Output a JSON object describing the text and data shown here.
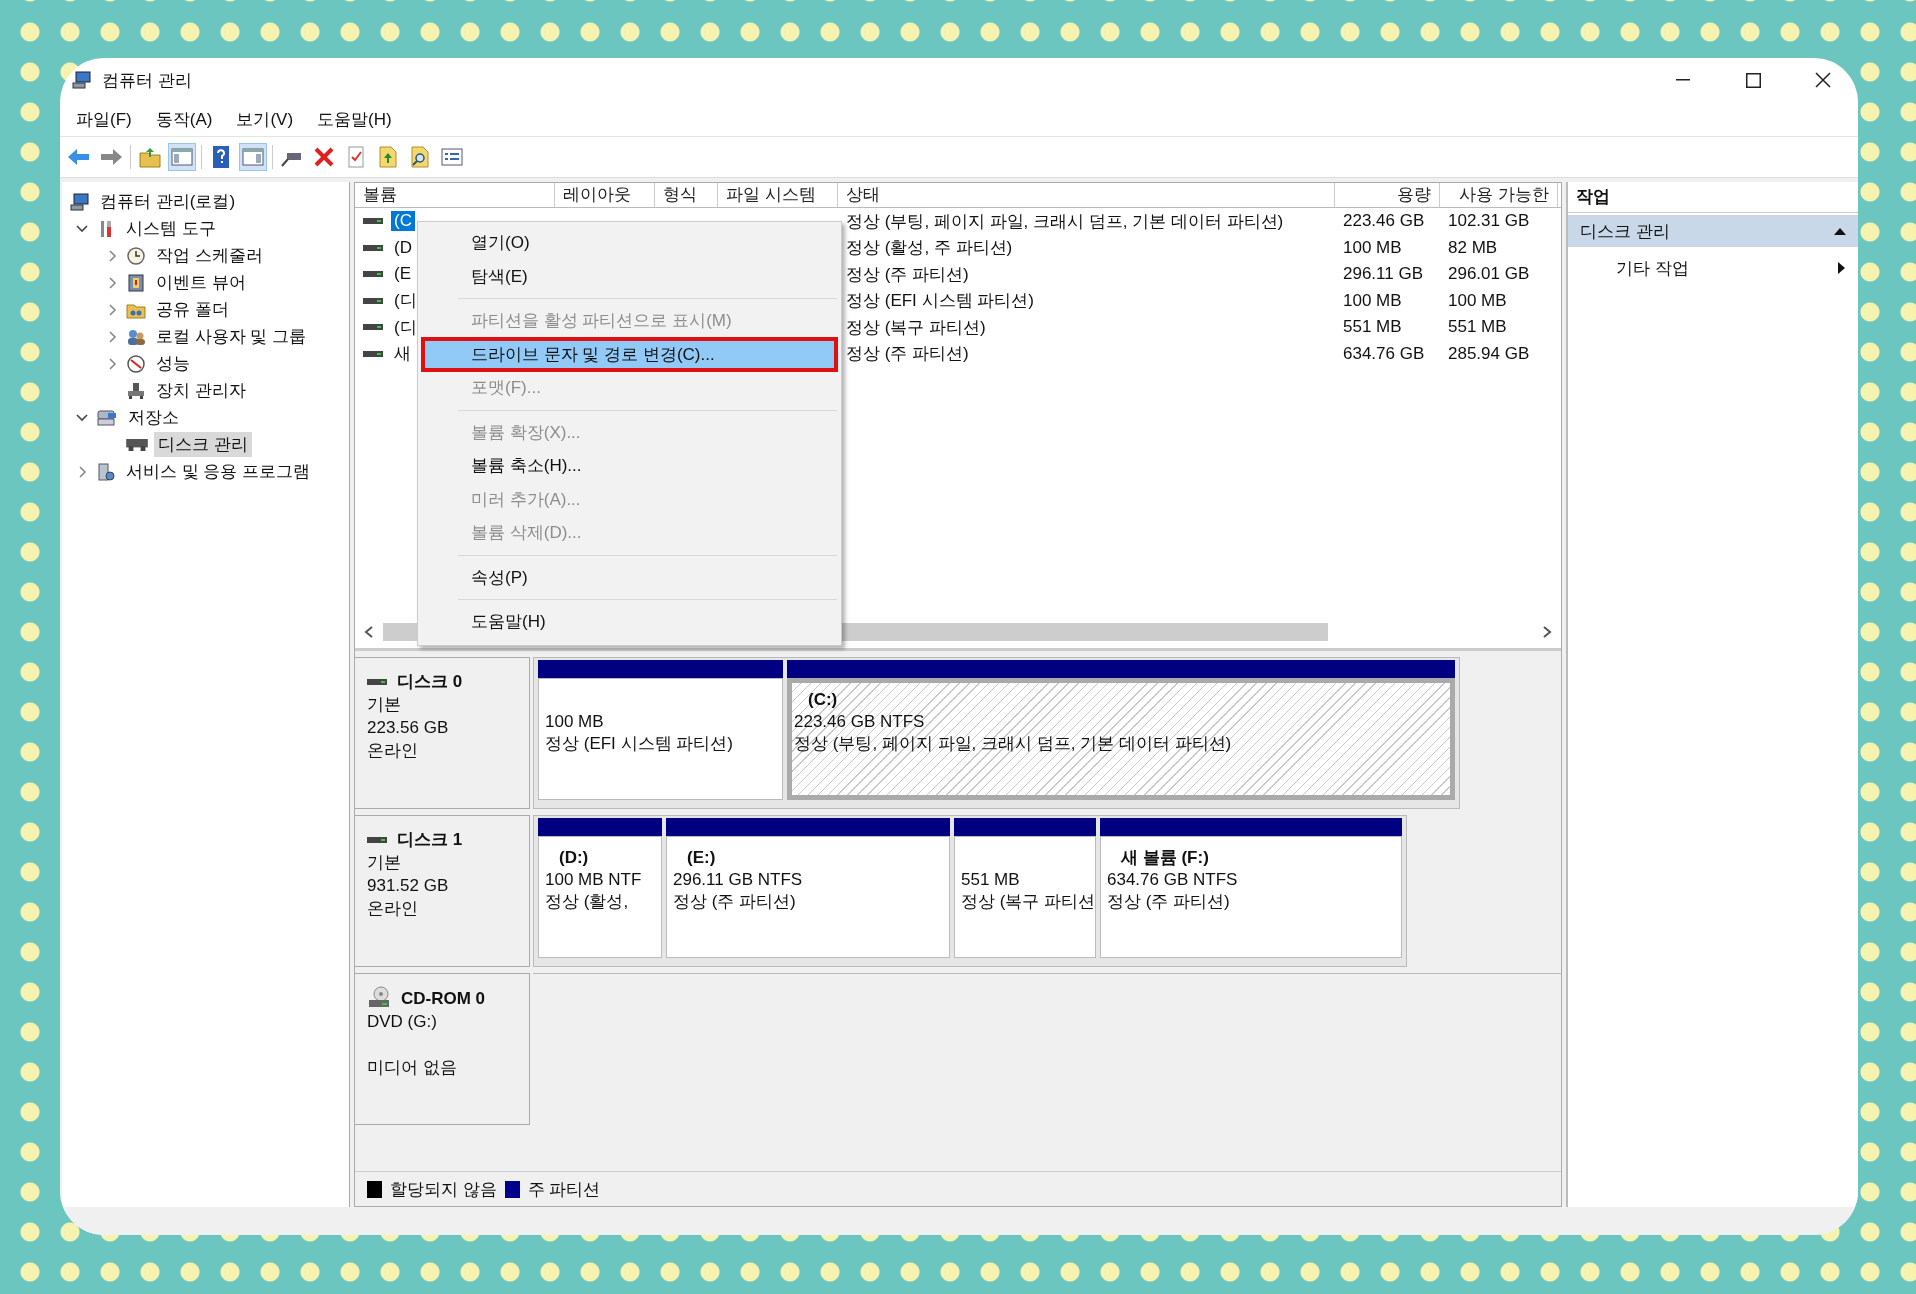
{
  "window": {
    "title": "컴퓨터 관리"
  },
  "menu": [
    "파일(F)",
    "동작(A)",
    "보기(V)",
    "도움말(H)"
  ],
  "tree": [
    {
      "label": "컴퓨터 관리(로컬)",
      "selected": false,
      "children": [
        {
          "label": "시스템 도구",
          "expanded": true,
          "selected": false,
          "children": [
            {
              "label": "작업 스케줄러",
              "expanded": false,
              "selected": false
            },
            {
              "label": "이벤트 뷰어",
              "expanded": false,
              "selected": false
            },
            {
              "label": "공유 폴더",
              "expanded": false,
              "selected": false
            },
            {
              "label": "로컬 사용자 및 그룹",
              "expanded": false,
              "selected": false
            },
            {
              "label": "성능",
              "expanded": false,
              "selected": false
            },
            {
              "label": "장치 관리자",
              "selected": false
            }
          ]
        },
        {
          "label": "저장소",
          "expanded": true,
          "selected": false,
          "children": [
            {
              "label": "디스크 관리",
              "selected": true
            }
          ]
        },
        {
          "label": "서비스 및 응용 프로그램",
          "expanded": false,
          "selected": false
        }
      ]
    }
  ],
  "table": {
    "columns": [
      "볼륨",
      "레이아웃",
      "형식",
      "파일 시스템",
      "상태",
      "용량",
      "사용 가능한"
    ],
    "rows": [
      {
        "volume": "(C",
        "status": "정상 (부팅, 페이지 파일, 크래시 덤프, 기본 데이터 파티션)",
        "capacity": "223.46 GB",
        "free": "102.31 GB",
        "selected": true
      },
      {
        "volume": "(D",
        "status": "정상 (활성, 주 파티션)",
        "capacity": "100 MB",
        "free": "82 MB",
        "selected": false
      },
      {
        "volume": "(E",
        "status": "정상 (주 파티션)",
        "capacity": "296.11 GB",
        "free": "296.01 GB",
        "selected": false
      },
      {
        "volume": "(디",
        "status": "정상 (EFI 시스템 파티션)",
        "capacity": "100 MB",
        "free": "100 MB",
        "selected": false
      },
      {
        "volume": "(디",
        "status": "정상 (복구 파티션)",
        "capacity": "551 MB",
        "free": "551 MB",
        "selected": false
      },
      {
        "volume": "새",
        "status": "정상 (주 파티션)",
        "capacity": "634.76 GB",
        "free": "285.94 GB",
        "selected": false
      }
    ]
  },
  "context_menu": [
    {
      "kind": "item",
      "label": "열기(O)",
      "disabled": false,
      "selected": false,
      "outlined": false
    },
    {
      "kind": "item",
      "label": "탐색(E)",
      "disabled": false,
      "selected": false,
      "outlined": false
    },
    {
      "kind": "separator"
    },
    {
      "kind": "item",
      "label": "파티션을 활성 파티션으로 표시(M)",
      "disabled": true,
      "selected": false,
      "outlined": false
    },
    {
      "kind": "item",
      "label": "드라이브 문자 및 경로 변경(C)...",
      "disabled": false,
      "selected": true,
      "outlined": true
    },
    {
      "kind": "item",
      "label": "포맷(F)...",
      "disabled": true,
      "selected": false,
      "outlined": false
    },
    {
      "kind": "separator"
    },
    {
      "kind": "item",
      "label": "볼륨 확장(X)...",
      "disabled": true,
      "selected": false,
      "outlined": false
    },
    {
      "kind": "item",
      "label": "볼륨 축소(H)...",
      "disabled": false,
      "selected": false,
      "outlined": false
    },
    {
      "kind": "item",
      "label": "미러 추가(A)...",
      "disabled": true,
      "selected": false,
      "outlined": false
    },
    {
      "kind": "item",
      "label": "볼륨 삭제(D)...",
      "disabled": true,
      "selected": false,
      "outlined": false
    },
    {
      "kind": "separator"
    },
    {
      "kind": "item",
      "label": "속성(P)",
      "disabled": false,
      "selected": false,
      "outlined": false
    },
    {
      "kind": "separator"
    },
    {
      "kind": "item",
      "label": "도움말(H)",
      "disabled": false,
      "selected": false,
      "outlined": false
    }
  ],
  "disks": [
    {
      "kind": "disk",
      "name": "디스크 0",
      "type": "기본",
      "size": "223.56 GB",
      "status": "온라인",
      "partitions": [
        {
          "size_fs": "100 MB",
          "status": "정상 (EFI 시스템 파티션)",
          "selected": false
        },
        {
          "label": "(C:)",
          "size_fs": "223.46 GB NTFS",
          "status": "정상 (부팅, 페이지 파일, 크래시 덤프, 기본 데이터 파티션)",
          "selected": true
        }
      ]
    },
    {
      "kind": "disk",
      "name": "디스크 1",
      "type": "기본",
      "size": "931.52 GB",
      "status": "온라인",
      "partitions": [
        {
          "label": "(D:)",
          "size_fs": "100 MB NTF",
          "status": "정상 (활성,",
          "selected": false
        },
        {
          "label": "(E:)",
          "size_fs": "296.11 GB NTFS",
          "status": "정상 (주 파티션)",
          "selected": false
        },
        {
          "size_fs": "551 MB",
          "status": "정상 (복구 파티션",
          "selected": false
        },
        {
          "label": "새 볼륨  (F:)",
          "size_fs": "634.76 GB NTFS",
          "status": "정상 (주 파티션)",
          "selected": false
        }
      ]
    },
    {
      "kind": "cdrom",
      "name": "CD-ROM 0",
      "type": "DVD (G:)",
      "status": "미디어 없음"
    }
  ],
  "legend": [
    {
      "label": "할당되지 않음",
      "color": "#000000"
    },
    {
      "label": "주 파티션",
      "color": "#00008b"
    }
  ],
  "actions": {
    "title": "작업",
    "section": {
      "label": "디스크 관리",
      "expanded": true
    },
    "items": [
      "기타 작업"
    ]
  }
}
